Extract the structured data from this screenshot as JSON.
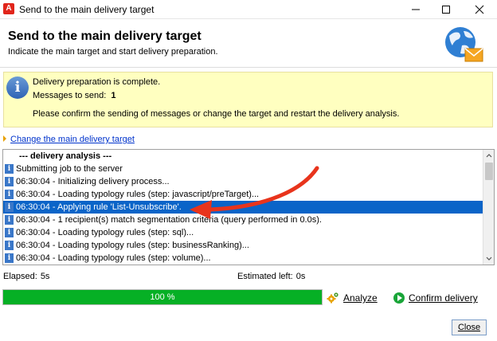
{
  "window": {
    "title": "Send to the main delivery target",
    "app_icon": "A",
    "controls": [
      "minimize-icon",
      "maximize-icon",
      "close-icon"
    ]
  },
  "header": {
    "title": "Send to the main delivery target",
    "subtitle": "Indicate the main target and start delivery preparation.",
    "icon": "globe-mail-icon"
  },
  "info": {
    "icon": "info-icon",
    "line1": "Delivery preparation is complete.",
    "messages_label": "Messages to send:",
    "messages_value": "1",
    "line3": "Please confirm the sending of messages or change the target and restart the delivery analysis.",
    "background": "#ffffc0"
  },
  "link": {
    "label": "Change the main delivery target"
  },
  "log": {
    "rows": [
      {
        "text": "--- delivery analysis ---",
        "type": "heading"
      },
      {
        "text": "Submitting job to the server",
        "type": "info"
      },
      {
        "text": "06:30:04 - Initializing delivery process...",
        "type": "info"
      },
      {
        "text": "06:30:04 - Loading typology rules (step: javascript/preTarget)...",
        "type": "info"
      },
      {
        "text": "06:30:04 - Applying rule 'List-Unsubscribe'.",
        "type": "selected"
      },
      {
        "text": "06:30:04 - 1 recipient(s) match segmentation criteria (query performed in 0.0s).",
        "type": "info"
      },
      {
        "text": "06:30:04 - Loading typology rules (step: sql)...",
        "type": "info"
      },
      {
        "text": "06:30:04 - Loading typology rules (step: businessRanking)...",
        "type": "info"
      },
      {
        "text": "06:30:04 - Loading typology rules (step: volume)...",
        "type": "info"
      }
    ],
    "selection_color": "#0a64c8"
  },
  "status": {
    "elapsed_label": "Elapsed:",
    "elapsed_value": "5s",
    "estimated_label": "Estimated left:",
    "estimated_value": "0s"
  },
  "progress": {
    "percent": 100,
    "label": "100 %",
    "color": "#06b025"
  },
  "actions": {
    "analyze_label": "Analyze",
    "confirm_label": "Confirm delivery",
    "close_label": "Close"
  },
  "annotation": {
    "arrow_color": "#e8341c"
  }
}
